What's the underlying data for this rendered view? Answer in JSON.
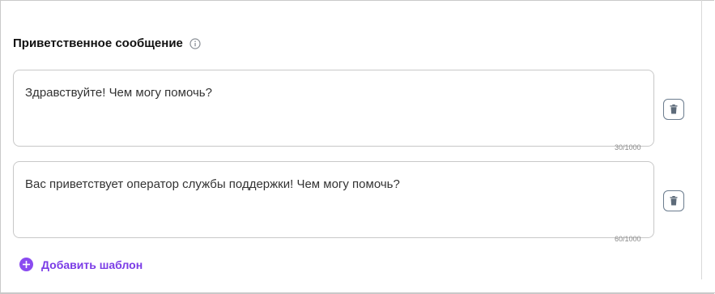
{
  "section": {
    "title": "Приветственное сообщение",
    "info_icon": "info-icon"
  },
  "templates": [
    {
      "text": "Здравствуйте! Чем могу помочь?",
      "counter": "30/1000",
      "delete_icon": "trash-icon"
    },
    {
      "text": "Вас приветствует оператор службы поддержки! Чем могу помочь?",
      "counter": "60/1000",
      "delete_icon": "trash-icon"
    }
  ],
  "add_button": {
    "label": "Добавить шаблон",
    "icon": "plus-circle-icon"
  },
  "colors": {
    "accent": "#8a4bf0",
    "border": "#c8c8c8",
    "icon_gray": "#5d6b7a"
  }
}
